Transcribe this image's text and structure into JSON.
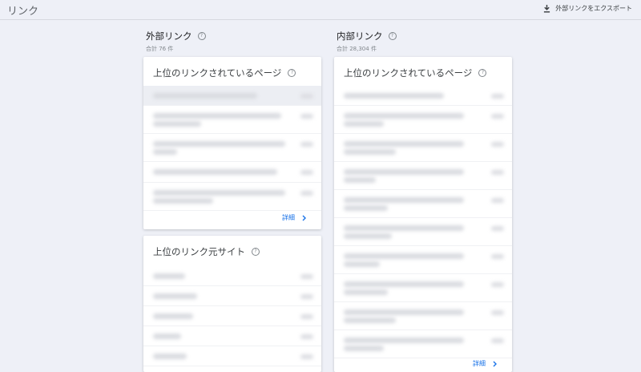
{
  "header": {
    "title": "リンク",
    "export_label": "外部リンクをエクスポート"
  },
  "external": {
    "title": "外部リンク",
    "total": "合計 76 件",
    "top_pages": {
      "title": "上位のリンクされているページ",
      "more_label": "詳細"
    },
    "top_sites": {
      "title": "上位のリンク元サイト"
    }
  },
  "internal": {
    "title": "内部リンク",
    "total": "合計 28,304 件",
    "top_pages": {
      "title": "上位のリンクされているページ",
      "more_label": "詳細"
    }
  },
  "icons": {
    "help": "help-circle-icon",
    "download": "download-icon",
    "more": "chevron-right-icon"
  },
  "colors": {
    "accent": "#1a73e8",
    "background": "#eef0f7"
  }
}
